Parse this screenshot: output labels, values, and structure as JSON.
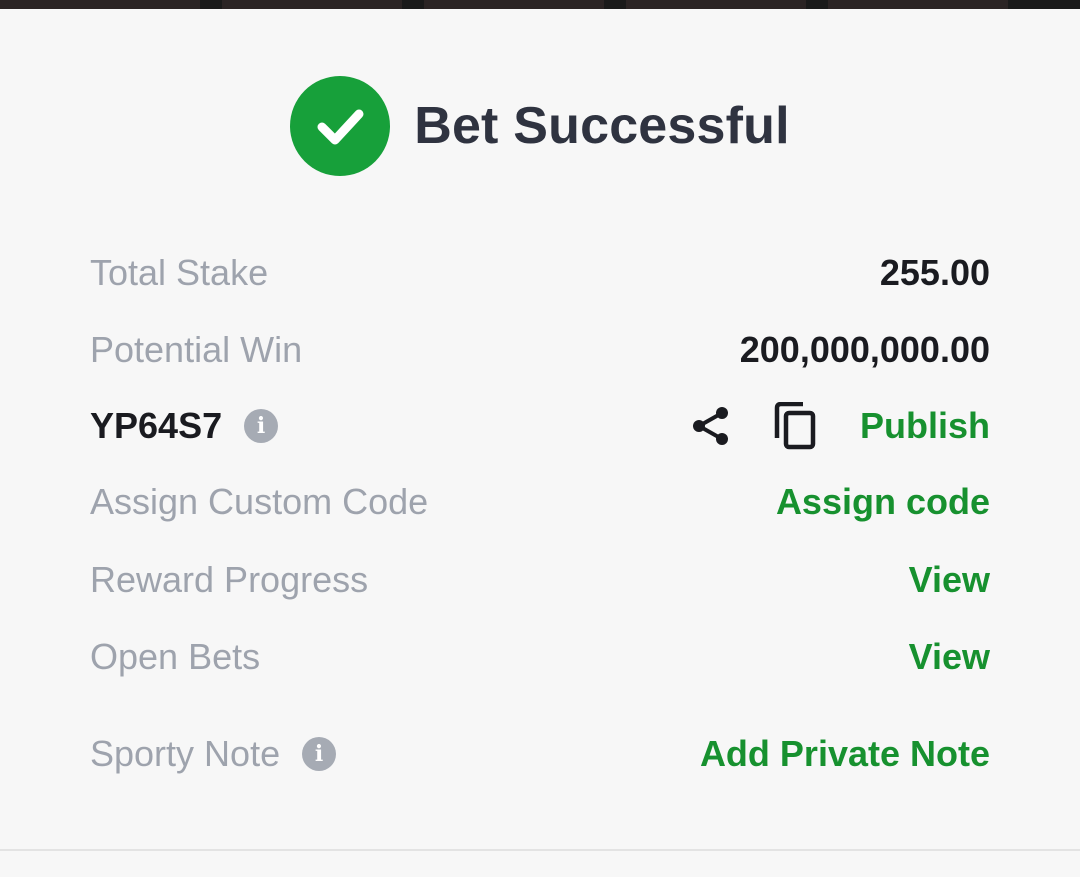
{
  "header": {
    "title": "Bet Successful"
  },
  "rows": {
    "total_stake": {
      "label": "Total Stake",
      "value": "255.00"
    },
    "potential_win": {
      "label": "Potential Win",
      "value": "200,000,000.00"
    },
    "booking": {
      "code": "YP64S7",
      "info_glyph": "i",
      "publish_label": "Publish"
    },
    "custom_code": {
      "label": "Assign Custom Code",
      "action": "Assign code"
    },
    "reward_progress": {
      "label": "Reward Progress",
      "action": "View"
    },
    "open_bets": {
      "label": "Open Bets",
      "action": "View"
    },
    "sporty_note": {
      "label": "Sporty Note",
      "info_glyph": "i",
      "action": "Add Private Note"
    }
  },
  "colors": {
    "accent_green": "#17912f",
    "success_circle": "#17a03a",
    "muted_label": "#9ea3ad",
    "title_text": "#2f3340"
  },
  "icons": {
    "success": "check-circle-icon",
    "share": "share-icon",
    "copy": "copy-icon",
    "info": "info-icon"
  }
}
